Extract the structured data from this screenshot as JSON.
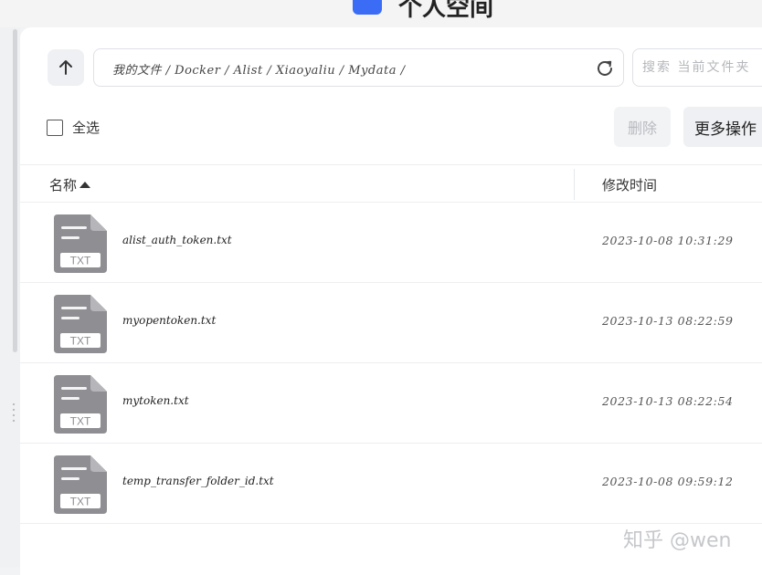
{
  "app": {
    "title": "个人空间"
  },
  "toolbar": {
    "path": "我的文件 / Docker / Alist / Xiaoyaliu / Mydata /",
    "search_placeholder": "搜索 当前文件夹",
    "select_all_label": "全选",
    "delete_label": "删除",
    "more_label": "更多操作"
  },
  "table": {
    "columns": {
      "name": "名称",
      "modified": "修改时间"
    },
    "rows": [
      {
        "name": "alist_auth_token.txt",
        "modified": "2023-10-08 10:31:29",
        "type": "TXT"
      },
      {
        "name": "myopentoken.txt",
        "modified": "2023-10-13 08:22:59",
        "type": "TXT"
      },
      {
        "name": "mytoken.txt",
        "modified": "2023-10-13 08:22:54",
        "type": "TXT"
      },
      {
        "name": "temp_transfer_folder_id.txt",
        "modified": "2023-10-08 09:59:12",
        "type": "TXT"
      }
    ]
  },
  "watermark": "知乎 @wen",
  "icons": [
    "arrow-up-icon",
    "refresh-icon",
    "txt-file-icon",
    "sort-ascending-icon"
  ],
  "colors": {
    "accent": "#3b6cf6",
    "file_icon": "#8e8e93"
  }
}
